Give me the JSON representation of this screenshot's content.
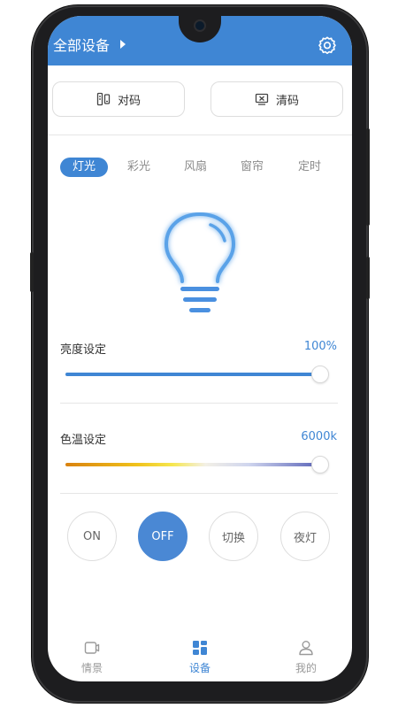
{
  "header": {
    "title": "全部设备"
  },
  "code_buttons": {
    "pair": "对码",
    "clear": "清码"
  },
  "tabs": [
    {
      "label": "灯光",
      "active": true
    },
    {
      "label": "彩光",
      "active": false
    },
    {
      "label": "风扇",
      "active": false
    },
    {
      "label": "窗帘",
      "active": false
    },
    {
      "label": "定时",
      "active": false
    }
  ],
  "brightness": {
    "label": "亮度设定",
    "value_text": "100%",
    "level": 1.0
  },
  "color_temp": {
    "label": "色温设定",
    "value_text": "6000k",
    "level": 1.0
  },
  "controls": [
    {
      "label": "ON",
      "active": false
    },
    {
      "label": "OFF",
      "active": true
    },
    {
      "label": "切换",
      "active": false
    },
    {
      "label": "夜灯",
      "active": false
    }
  ],
  "bottom_nav": [
    {
      "label": "情景",
      "icon": "scene-icon",
      "active": false
    },
    {
      "label": "设备",
      "icon": "device-grid-icon",
      "active": true
    },
    {
      "label": "我的",
      "icon": "user-icon",
      "active": false
    }
  ],
  "colors": {
    "accent": "#3f86d4",
    "header": "#3f86d4",
    "off_button": "#4a88d4"
  }
}
